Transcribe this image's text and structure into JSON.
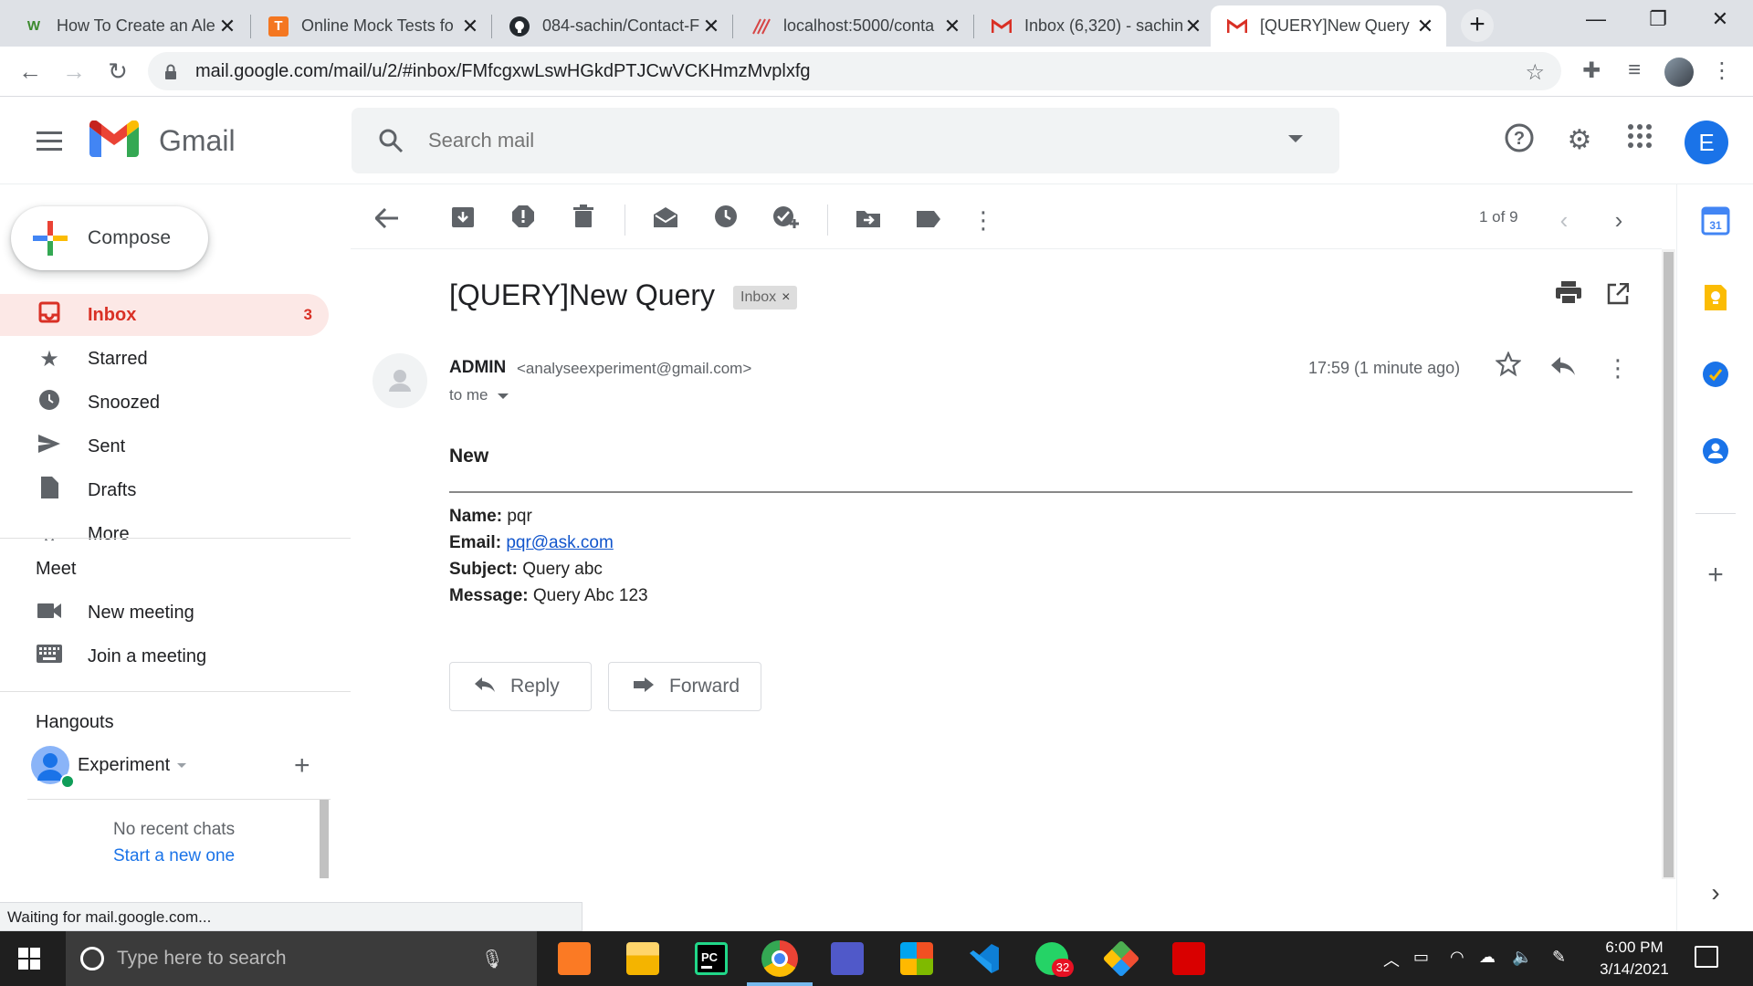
{
  "browser": {
    "tabs": [
      {
        "title": "How To Create an Ale",
        "favicon": "W",
        "close": "✕"
      },
      {
        "title": "Online Mock Tests fo",
        "favicon": "T",
        "close": "✕"
      },
      {
        "title": "084-sachin/Contact-F",
        "favicon": "github",
        "close": "✕"
      },
      {
        "title": "localhost:5000/conta",
        "favicon": "slash",
        "close": "✕"
      },
      {
        "title": "Inbox (6,320) - sachin",
        "favicon": "M",
        "close": "✕"
      },
      {
        "title": "[QUERY]New Query",
        "favicon": "M",
        "close": "✕"
      }
    ],
    "new_tab": "+",
    "url": "mail.google.com/mail/u/2/#inbox/FMfcgxwLswHGkdPTJCwVCKHmzMvplxfg"
  },
  "gmail": {
    "app_name": "Gmail",
    "search_placeholder": "Search mail",
    "account_initial": "E",
    "compose_label": "Compose",
    "nav": [
      {
        "label": "Inbox",
        "count": "3"
      },
      {
        "label": "Starred",
        "count": ""
      },
      {
        "label": "Snoozed",
        "count": ""
      },
      {
        "label": "Sent",
        "count": ""
      },
      {
        "label": "Drafts",
        "count": ""
      },
      {
        "label": "More",
        "count": ""
      }
    ],
    "meet": {
      "title": "Meet",
      "new_meeting": "New meeting",
      "join_meeting": "Join a meeting"
    },
    "hangouts": {
      "title": "Hangouts",
      "user": "Experiment",
      "no_recent": "No recent chats",
      "start_new": "Start a new one"
    },
    "pager": "1 of 9"
  },
  "message": {
    "subject": "[QUERY]New Query",
    "label": "Inbox",
    "label_remove": "×",
    "sender_name": "ADMIN",
    "sender_email": "<analyseexperiment@gmail.com>",
    "to": "to me",
    "time": "17:59 (1 minute ago)",
    "heading": "New",
    "fields": [
      {
        "key": "Name:",
        "value": "pqr"
      },
      {
        "key": "Email:",
        "value": "pqr@ask.com"
      },
      {
        "key": "Subject:",
        "value": "Query abc"
      },
      {
        "key": "Message:",
        "value": "Query Abc 123"
      }
    ],
    "reply_label": "Reply",
    "forward_label": "Forward"
  },
  "status_text": "Waiting for mail.google.com...",
  "taskbar": {
    "search_placeholder": "Type here to search",
    "whatsapp_badge": "32",
    "time": "6:00 PM",
    "date": "3/14/2021"
  },
  "colors": {
    "gmail_red": "#d93025",
    "accent_blue": "#1a73e8",
    "inbox_active_bg": "#fce8e6"
  }
}
